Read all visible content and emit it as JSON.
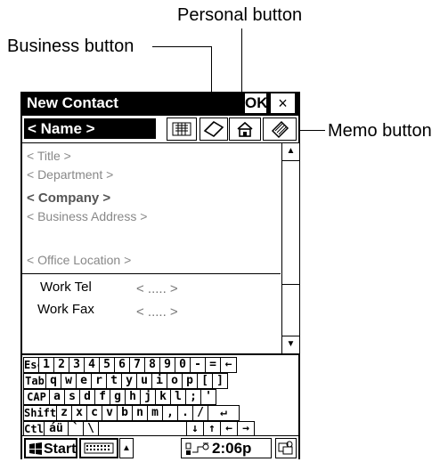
{
  "callouts": {
    "personal": "Personal button",
    "business": "Business button",
    "memo": "Memo button"
  },
  "window": {
    "title": "New Contact",
    "ok_label": "OK",
    "close_label": "×"
  },
  "name_field": {
    "value": "< Name >"
  },
  "tabs": [
    "address-card-icon",
    "business-icon",
    "home-icon",
    "memo-icon"
  ],
  "form": {
    "title": "< Title >",
    "department": "< Department >",
    "company": "< Company >",
    "business_address": "< Business Address >",
    "office_location": "< Office Location >",
    "work_tel_label": "Work Tel",
    "work_tel_value": "< ..... >",
    "work_fax_label": "Work Fax",
    "work_fax_value": "< ..... >"
  },
  "keyboard": {
    "rows": [
      [
        "Esc",
        "1",
        "2",
        "3",
        "4",
        "5",
        "6",
        "7",
        "8",
        "9",
        "0",
        "-",
        "=",
        "←"
      ],
      [
        "Tab",
        "q",
        "w",
        "e",
        "r",
        "t",
        "y",
        "u",
        "i",
        "o",
        "p",
        "[",
        "]"
      ],
      [
        "CAP",
        "a",
        "s",
        "d",
        "f",
        "g",
        "h",
        "j",
        "k",
        "l",
        ";",
        "'"
      ],
      [
        "Shift",
        "z",
        "x",
        "c",
        "v",
        "b",
        "n",
        "m",
        ",",
        ".",
        "/",
        "↵"
      ],
      [
        "Ctl",
        "áü",
        "`",
        "\\",
        " ",
        "↓",
        "↑",
        "←",
        "→"
      ]
    ]
  },
  "taskbar": {
    "start_label": "Start",
    "time": "2:06p"
  }
}
